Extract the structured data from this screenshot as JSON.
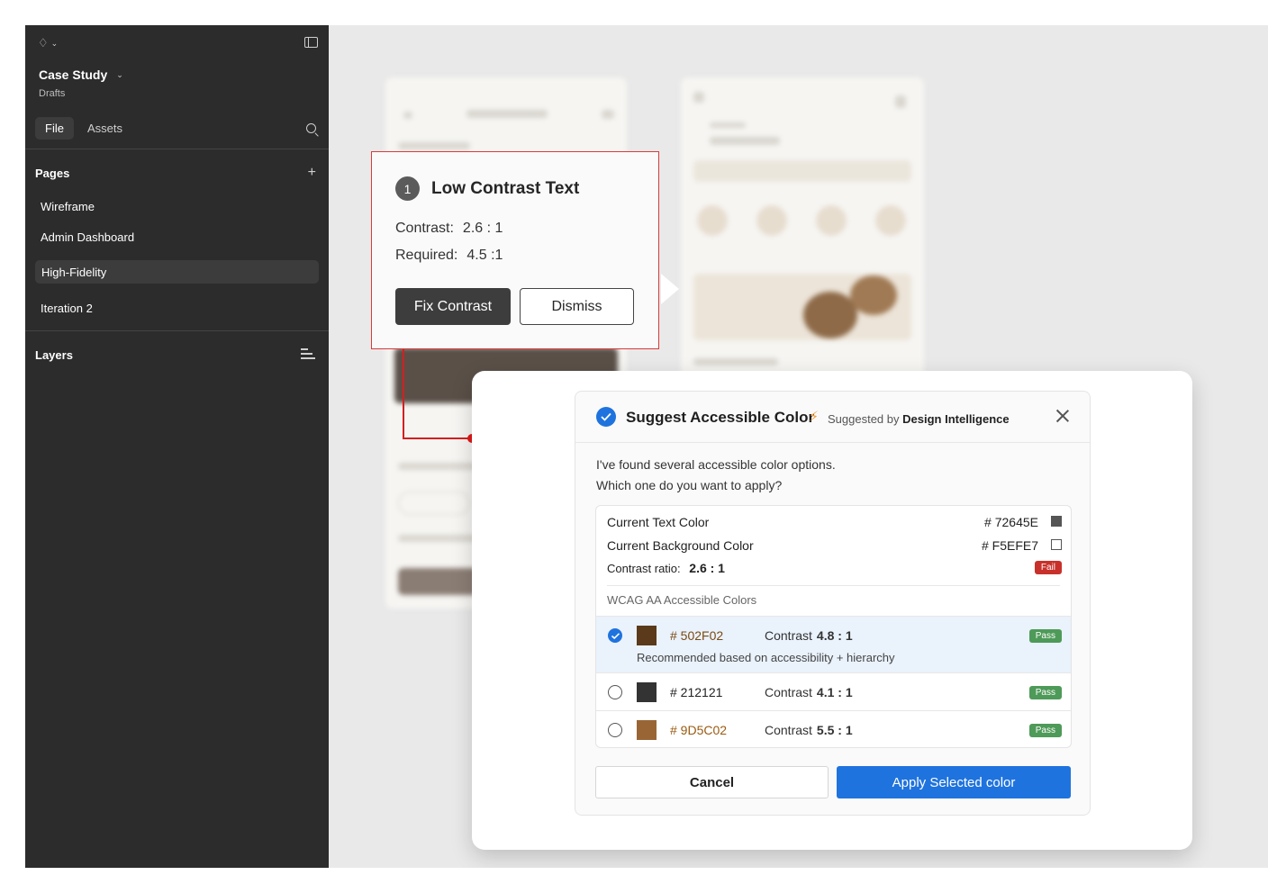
{
  "sidebar": {
    "project_title": "Case Study",
    "project_subtitle": "Drafts",
    "tabs": [
      {
        "label": "File"
      },
      {
        "label": "Assets"
      }
    ],
    "pages_title": "Pages",
    "pages": [
      {
        "label": "Wireframe"
      },
      {
        "label": "Admin Dashboard"
      },
      {
        "label": "High-Fidelity",
        "selected": true
      },
      {
        "label": "Iteration 2"
      }
    ],
    "layers_title": "Layers"
  },
  "annotation": {
    "number": "1",
    "title": "Low Contrast Text",
    "contrast_label": "Contrast:",
    "contrast_value": "2.6 : 1",
    "required_label": "Required:",
    "required_value": "4.5 :1",
    "fix_label": "Fix Contrast",
    "dismiss_label": "Dismiss",
    "accent_color": "#d41f1f"
  },
  "modal": {
    "title": "Suggest Accessible Color",
    "suggested_prefix": "Suggested by",
    "suggested_by": "Design Intelligence",
    "intro_line1": "I've found several accessible color options.",
    "intro_line2": "Which one do you want to apply?",
    "current_text_label": "Current Text Color",
    "current_text_hex": "# 72645E",
    "current_text_color": "#555555",
    "current_bg_label": "Current Background Color",
    "current_bg_hex": "# F5EFE7",
    "contrast_ratio_label": "Contrast ratio:",
    "contrast_ratio_value": "2.6 : 1",
    "fail_label": "Fail",
    "section_label": "WCAG AA Accessible Colors",
    "contrast_word": "Contrast",
    "options": [
      {
        "hex": "# 502F02",
        "color": "#5a3a1a",
        "hex_color": "#7a4a12",
        "contrast": "4.8 :  1",
        "badge": "Pass",
        "selected": true,
        "note": "Recommended based on accessibility + hierarchy"
      },
      {
        "hex": "# 212121",
        "color": "#333333",
        "hex_color": "#222222",
        "contrast": "4.1 : 1",
        "badge": "Pass",
        "selected": false
      },
      {
        "hex": "# 9D5C02",
        "color": "#9a6535",
        "hex_color": "#9a5a10",
        "contrast": "5.5 : 1",
        "badge": "Pass",
        "selected": false
      }
    ],
    "cancel_label": "Cancel",
    "apply_label": "Apply Selected color",
    "primary_color": "#1f73de"
  }
}
